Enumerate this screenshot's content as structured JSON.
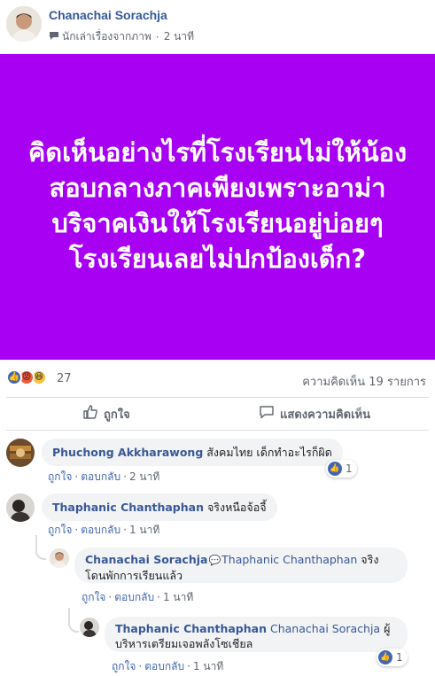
{
  "post": {
    "author": "Chanachai Sorachja",
    "source_label": "นักเล่าเรื่องจากภาพ",
    "separator": "·",
    "time": "2 นาที",
    "banner_color": "#a700f3",
    "banner_text": "คิดเห็นอย่างไรที่โรงเรียนไม่ให้น้องสอบกลางภาคเพียงเพราะอาม่าบริจาคเงินให้โรงเรียนอยู่บ่อยๆ โรงเรียนเลยไม่ปกป้องเด็ก?",
    "reaction_count": "27",
    "reactions": [
      "like",
      "angry",
      "haha"
    ],
    "comment_count": "ความคิดเห็น 19 รายการ",
    "actions": {
      "like": "ถูกใจ",
      "comment": "แสดงความคิดเห็น"
    }
  },
  "comments": [
    {
      "name": "Phuchong Akkharawong",
      "text": "สังคมไทย เด็กทำอะไรก็ผิด",
      "like_label": "ถูกใจ",
      "reply_label": "ตอบกลับ",
      "time": "2 นาที",
      "reaction_count": "1"
    },
    {
      "name": "Thaphanic Chanthaphan",
      "text": "จริงหนือจ้อจี้",
      "like_label": "ถูกใจ",
      "reply_label": "ตอบกลับ",
      "time": "1 นาที"
    }
  ],
  "replies": [
    {
      "name": "Chanachai Sorachja",
      "mention": "Thaphanic Chanthaphan",
      "text_line1": "จริง",
      "text_line2": "โดนพักการเรียนแล้ว",
      "like_label": "ถูกใจ",
      "reply_label": "ตอบกลับ",
      "time": "1 นาที"
    },
    {
      "name": "Thaphanic Chanthaphan",
      "mention": "Chanachai Sorachja",
      "text_line1": "ผู้",
      "text_line2": "บริหารเตรียมเจอพลังโซเชียล",
      "like_label": "ถูกใจ",
      "reply_label": "ตอบกลับ",
      "time": "1 นาที",
      "reaction_count": "1"
    }
  ],
  "colors": {
    "link_blue": "#385898",
    "like_blue": "#4267b2",
    "bubble_gray": "#f2f3f5"
  }
}
